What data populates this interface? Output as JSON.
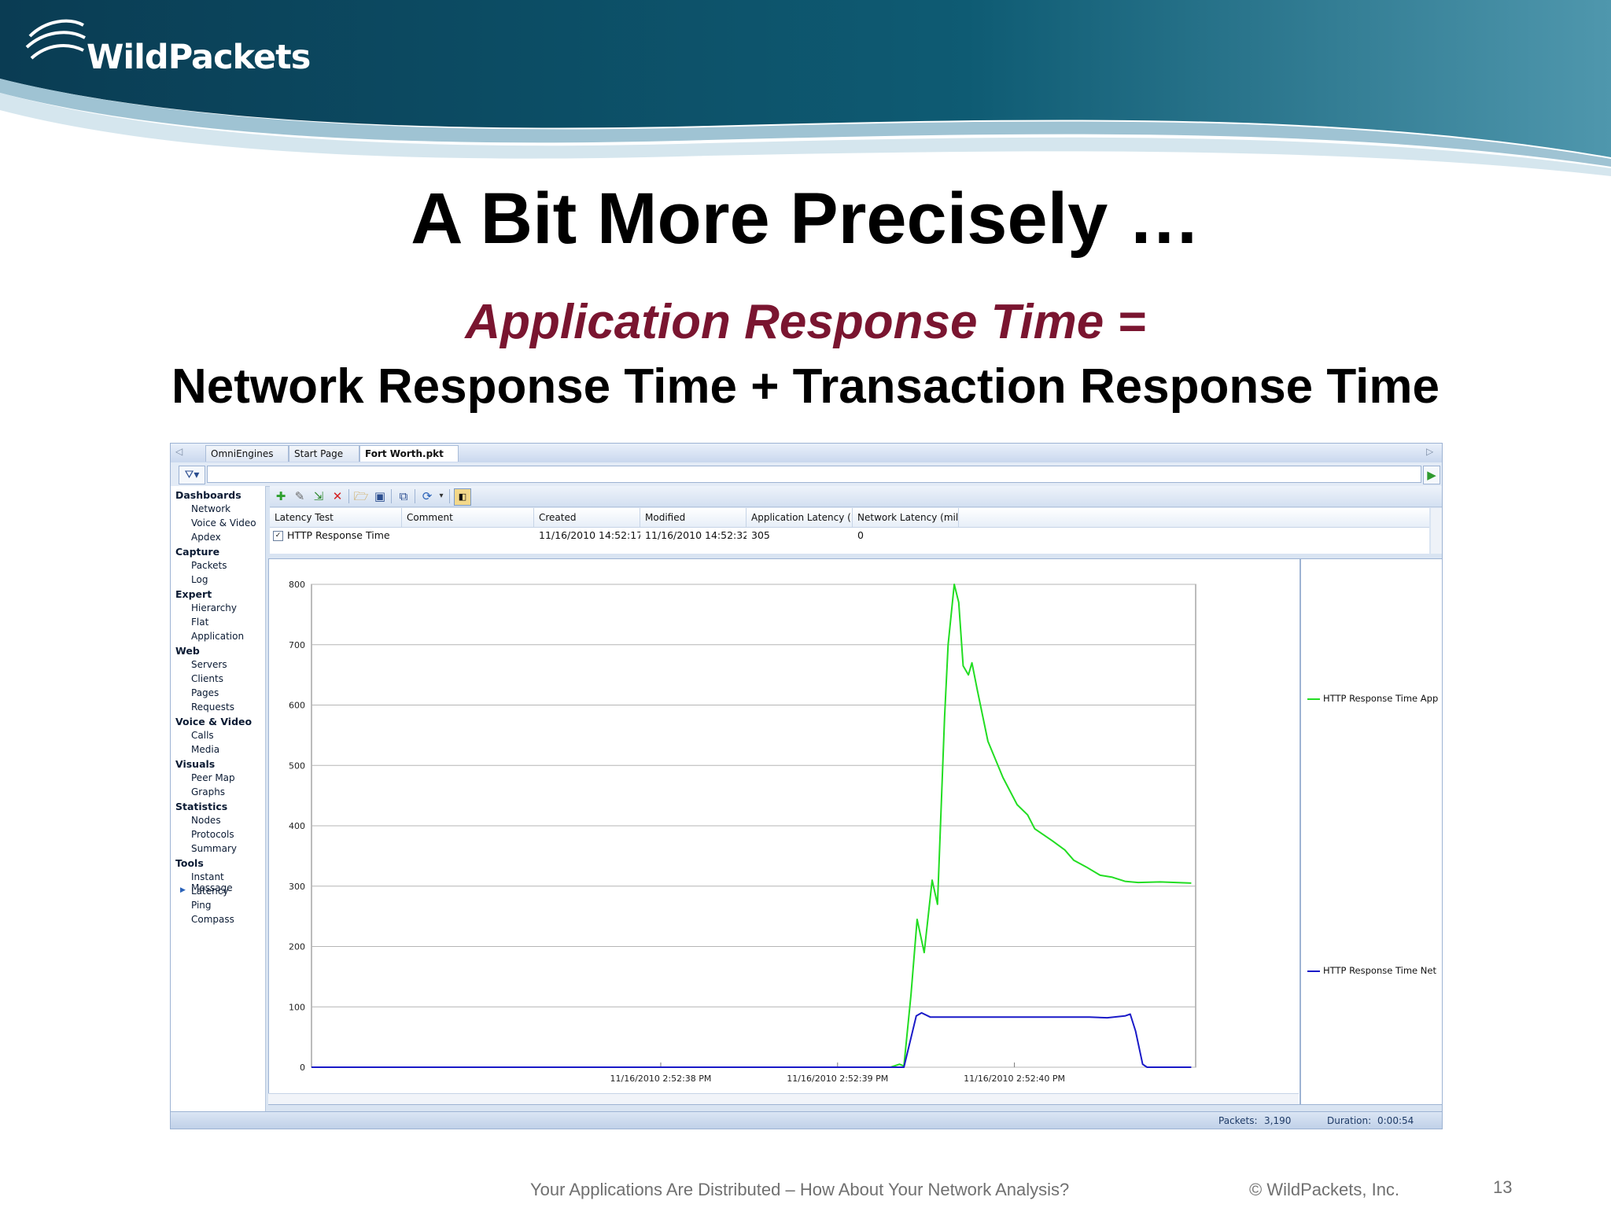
{
  "slide": {
    "logo_text": "WildPackets",
    "title": "A Bit More Precisely …",
    "subtitle": "Application Response Time =",
    "subtitle2": "Network Response Time + Transaction Response Time",
    "footer_title": "Your Applications Are Distributed – How About Your Network Analysis?",
    "footer_copyright": "©  WildPackets, Inc.",
    "page_number": "13",
    "colors": {
      "banner": "#0c4a60",
      "subtitle": "#7a1530"
    }
  },
  "app": {
    "tabs": [
      {
        "label": "OmniEngines",
        "active": false
      },
      {
        "label": "Start Page",
        "active": false
      },
      {
        "label": "Fort Worth.pkt",
        "active": true
      }
    ],
    "tab_close_icon": "close-icon",
    "sidebar": [
      {
        "group": "Dashboards",
        "items": [
          "Network",
          "Voice & Video",
          "Apdex"
        ]
      },
      {
        "group": "Capture",
        "items": [
          "Packets",
          "Log"
        ]
      },
      {
        "group": "Expert",
        "items": [
          "Hierarchy",
          "Flat",
          "Application"
        ]
      },
      {
        "group": "Web",
        "items": [
          "Servers",
          "Clients",
          "Pages",
          "Requests"
        ]
      },
      {
        "group": "Voice & Video",
        "items": [
          "Calls",
          "Media"
        ]
      },
      {
        "group": "Visuals",
        "items": [
          "Peer Map",
          "Graphs"
        ]
      },
      {
        "group": "Statistics",
        "items": [
          "Nodes",
          "Protocols",
          "Summary"
        ]
      },
      {
        "group": "Tools",
        "items": [
          "Instant Message",
          "Latency",
          "Ping",
          "Compass"
        ]
      }
    ],
    "selected_nav": "Latency",
    "toolbar_icons": [
      "add-icon",
      "edit-icon",
      "import-icon",
      "delete-icon",
      "open-icon",
      "save-icon",
      "copy-icon",
      "refresh-icon",
      "dropdown-icon",
      "options-icon"
    ],
    "grid": {
      "columns": [
        "Latency Test",
        "Comment",
        "Created",
        "Modified",
        "Application Latency (...",
        "Network Latency (mil..."
      ],
      "rows": [
        {
          "checked": true,
          "cells": [
            "HTTP Response Time",
            "",
            "11/16/2010 14:52:17",
            "11/16/2010 14:52:32",
            "305",
            "0"
          ]
        }
      ]
    },
    "legend": [
      {
        "label": "HTTP Response Time App",
        "color": "#22dd22"
      },
      {
        "label": "HTTP Response Time Net",
        "color": "#1a1ac8"
      }
    ],
    "status": {
      "packets_label": "Packets:",
      "packets_value": "3,190",
      "duration_label": "Duration:",
      "duration_value": "0:00:54"
    }
  },
  "chart_data": {
    "type": "line",
    "title": "",
    "xlabel": "",
    "ylabel": "",
    "ylim": [
      0,
      800
    ],
    "yticks": [
      0,
      100,
      200,
      300,
      400,
      500,
      600,
      700,
      800
    ],
    "xticks": [
      {
        "x": 0.395,
        "label": "11/16/2010 2:52:38 PM"
      },
      {
        "x": 0.595,
        "label": "11/16/2010 2:52:39 PM"
      },
      {
        "x": 0.795,
        "label": "11/16/2010 2:52:40 PM"
      }
    ],
    "grid": true,
    "legend_position": "right",
    "series": [
      {
        "name": "HTTP Response Time App",
        "color": "#22dd22",
        "points": [
          [
            0.0,
            0
          ],
          [
            0.635,
            0
          ],
          [
            0.655,
            0
          ],
          [
            0.665,
            5
          ],
          [
            0.67,
            2
          ],
          [
            0.678,
            120
          ],
          [
            0.685,
            245
          ],
          [
            0.693,
            190
          ],
          [
            0.702,
            310
          ],
          [
            0.708,
            270
          ],
          [
            0.716,
            580
          ],
          [
            0.72,
            700
          ],
          [
            0.727,
            800
          ],
          [
            0.732,
            770
          ],
          [
            0.737,
            665
          ],
          [
            0.743,
            650
          ],
          [
            0.747,
            670
          ],
          [
            0.753,
            625
          ],
          [
            0.765,
            540
          ],
          [
            0.782,
            480
          ],
          [
            0.798,
            435
          ],
          [
            0.81,
            418
          ],
          [
            0.818,
            395
          ],
          [
            0.838,
            375
          ],
          [
            0.852,
            360
          ],
          [
            0.862,
            343
          ],
          [
            0.876,
            332
          ],
          [
            0.892,
            318
          ],
          [
            0.905,
            315
          ],
          [
            0.92,
            308
          ],
          [
            0.935,
            306
          ],
          [
            0.96,
            307
          ],
          [
            0.995,
            305
          ]
        ]
      },
      {
        "name": "HTTP Response Time Net",
        "color": "#1a1ac8",
        "points": [
          [
            0.0,
            0
          ],
          [
            0.67,
            0
          ],
          [
            0.684,
            85
          ],
          [
            0.69,
            90
          ],
          [
            0.7,
            83
          ],
          [
            0.74,
            83
          ],
          [
            0.8,
            83
          ],
          [
            0.85,
            83
          ],
          [
            0.88,
            83
          ],
          [
            0.9,
            82
          ],
          [
            0.92,
            85
          ],
          [
            0.926,
            88
          ],
          [
            0.932,
            60
          ],
          [
            0.94,
            5
          ],
          [
            0.945,
            0
          ],
          [
            0.995,
            0
          ]
        ]
      }
    ]
  }
}
